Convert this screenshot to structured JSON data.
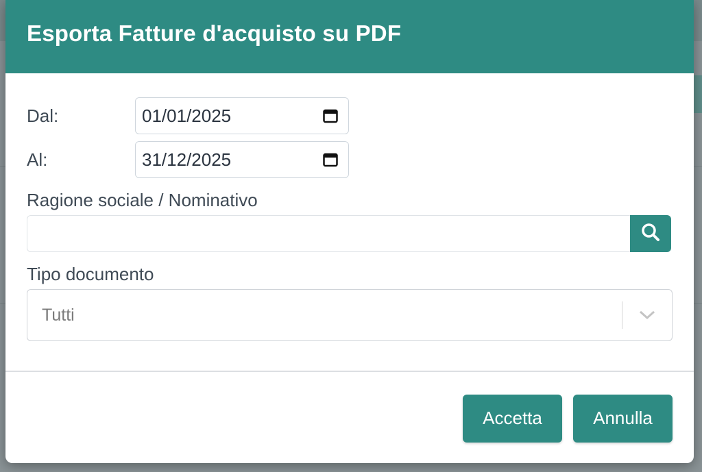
{
  "dialog": {
    "title": "Esporta Fatture d'acquisto su PDF",
    "header_color": "#2e8b83"
  },
  "form": {
    "from_label": "Dal:",
    "from_value": "01/01/2025",
    "to_label": "Al:",
    "to_value": "31/12/2025",
    "supplier_label": "Ragione sociale / Nominativo",
    "supplier_value": "",
    "doc_type_label": "Tipo documento",
    "doc_type_value": "Tutti"
  },
  "icons": {
    "calendar": "calendar-icon",
    "search": "search-icon",
    "dropdown": "chevron-down-icon"
  },
  "footer": {
    "accept_label": "Accetta",
    "cancel_label": "Annulla"
  }
}
